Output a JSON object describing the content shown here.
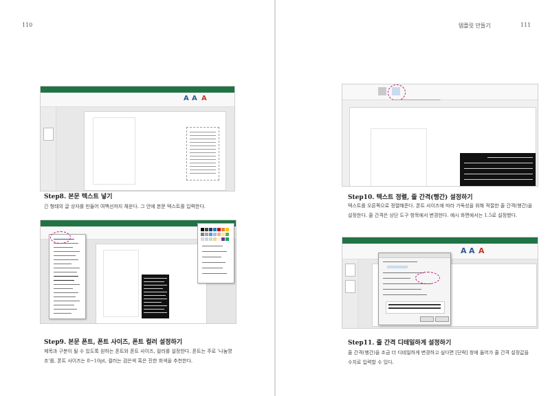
{
  "left_page": {
    "page_number": "110",
    "steps": [
      {
        "title": "Step8. 본문 텍스트 넣기",
        "body": "긴 형태의 글 상자를 만들어 여백선까지 채운다. 그 안에 본문 텍스트를 입력한다."
      },
      {
        "title": "Step9. 본문 폰트, 폰트 사이즈, 폰트 컬러 설정하기",
        "body": "제목과 구분이 될 수 있도록 원하는 폰트와 폰트 사이즈, 컬러를 설정한다. 폰트는 주로 '나눔명조'를, 폰트 사이즈는 8~10pt, 컬러는 검은색 혹은 진한 회색을 추천한다."
      }
    ]
  },
  "right_page": {
    "running_head": "템플릿 만들기",
    "page_number": "111",
    "steps": [
      {
        "title": "Step10. 텍스트 정렬, 줄 간격(행간) 설정하기",
        "body": "텍스트를 오른쪽으로 정렬해준다. 폰트 사이즈에 따라 가독성을 위해 적절한 줄 간격(행간)을 설정한다. 줄 간격은 상단 도구 항목에서 변경한다. 예시 화면에서는 1.5로 설정했다."
      },
      {
        "title": "Step11. 줄 간격 디테일하게 설정하기",
        "body": "줄 간격(행간)을 조금 더 디테일하게 변경하고 싶다면 [단락] 창에 들어가 줄 간격 설정값을 수치로 입력할 수 있다."
      }
    ]
  },
  "colors": {
    "ribbon": "#217346",
    "highlight_circle": "#c2187a",
    "page": "#ffffff",
    "text_dark": "#111111"
  }
}
